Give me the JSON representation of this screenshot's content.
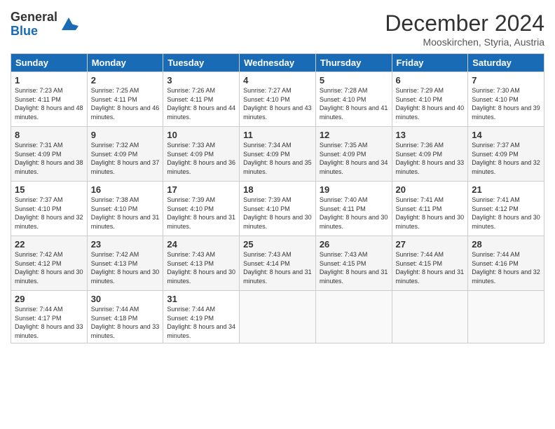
{
  "logo": {
    "general": "General",
    "blue": "Blue"
  },
  "header": {
    "month": "December 2024",
    "location": "Mooskirchen, Styria, Austria"
  },
  "weekdays": [
    "Sunday",
    "Monday",
    "Tuesday",
    "Wednesday",
    "Thursday",
    "Friday",
    "Saturday"
  ],
  "weeks": [
    [
      {
        "day": "1",
        "sunrise": "7:23 AM",
        "sunset": "4:11 PM",
        "daylight": "8 hours and 48 minutes."
      },
      {
        "day": "2",
        "sunrise": "7:25 AM",
        "sunset": "4:11 PM",
        "daylight": "8 hours and 46 minutes."
      },
      {
        "day": "3",
        "sunrise": "7:26 AM",
        "sunset": "4:11 PM",
        "daylight": "8 hours and 44 minutes."
      },
      {
        "day": "4",
        "sunrise": "7:27 AM",
        "sunset": "4:10 PM",
        "daylight": "8 hours and 43 minutes."
      },
      {
        "day": "5",
        "sunrise": "7:28 AM",
        "sunset": "4:10 PM",
        "daylight": "8 hours and 41 minutes."
      },
      {
        "day": "6",
        "sunrise": "7:29 AM",
        "sunset": "4:10 PM",
        "daylight": "8 hours and 40 minutes."
      },
      {
        "day": "7",
        "sunrise": "7:30 AM",
        "sunset": "4:10 PM",
        "daylight": "8 hours and 39 minutes."
      }
    ],
    [
      {
        "day": "8",
        "sunrise": "7:31 AM",
        "sunset": "4:09 PM",
        "daylight": "8 hours and 38 minutes."
      },
      {
        "day": "9",
        "sunrise": "7:32 AM",
        "sunset": "4:09 PM",
        "daylight": "8 hours and 37 minutes."
      },
      {
        "day": "10",
        "sunrise": "7:33 AM",
        "sunset": "4:09 PM",
        "daylight": "8 hours and 36 minutes."
      },
      {
        "day": "11",
        "sunrise": "7:34 AM",
        "sunset": "4:09 PM",
        "daylight": "8 hours and 35 minutes."
      },
      {
        "day": "12",
        "sunrise": "7:35 AM",
        "sunset": "4:09 PM",
        "daylight": "8 hours and 34 minutes."
      },
      {
        "day": "13",
        "sunrise": "7:36 AM",
        "sunset": "4:09 PM",
        "daylight": "8 hours and 33 minutes."
      },
      {
        "day": "14",
        "sunrise": "7:37 AM",
        "sunset": "4:09 PM",
        "daylight": "8 hours and 32 minutes."
      }
    ],
    [
      {
        "day": "15",
        "sunrise": "7:37 AM",
        "sunset": "4:10 PM",
        "daylight": "8 hours and 32 minutes."
      },
      {
        "day": "16",
        "sunrise": "7:38 AM",
        "sunset": "4:10 PM",
        "daylight": "8 hours and 31 minutes."
      },
      {
        "day": "17",
        "sunrise": "7:39 AM",
        "sunset": "4:10 PM",
        "daylight": "8 hours and 31 minutes."
      },
      {
        "day": "18",
        "sunrise": "7:39 AM",
        "sunset": "4:10 PM",
        "daylight": "8 hours and 30 minutes."
      },
      {
        "day": "19",
        "sunrise": "7:40 AM",
        "sunset": "4:11 PM",
        "daylight": "8 hours and 30 minutes."
      },
      {
        "day": "20",
        "sunrise": "7:41 AM",
        "sunset": "4:11 PM",
        "daylight": "8 hours and 30 minutes."
      },
      {
        "day": "21",
        "sunrise": "7:41 AM",
        "sunset": "4:12 PM",
        "daylight": "8 hours and 30 minutes."
      }
    ],
    [
      {
        "day": "22",
        "sunrise": "7:42 AM",
        "sunset": "4:12 PM",
        "daylight": "8 hours and 30 minutes."
      },
      {
        "day": "23",
        "sunrise": "7:42 AM",
        "sunset": "4:13 PM",
        "daylight": "8 hours and 30 minutes."
      },
      {
        "day": "24",
        "sunrise": "7:43 AM",
        "sunset": "4:13 PM",
        "daylight": "8 hours and 30 minutes."
      },
      {
        "day": "25",
        "sunrise": "7:43 AM",
        "sunset": "4:14 PM",
        "daylight": "8 hours and 31 minutes."
      },
      {
        "day": "26",
        "sunrise": "7:43 AM",
        "sunset": "4:15 PM",
        "daylight": "8 hours and 31 minutes."
      },
      {
        "day": "27",
        "sunrise": "7:44 AM",
        "sunset": "4:15 PM",
        "daylight": "8 hours and 31 minutes."
      },
      {
        "day": "28",
        "sunrise": "7:44 AM",
        "sunset": "4:16 PM",
        "daylight": "8 hours and 32 minutes."
      }
    ],
    [
      {
        "day": "29",
        "sunrise": "7:44 AM",
        "sunset": "4:17 PM",
        "daylight": "8 hours and 33 minutes."
      },
      {
        "day": "30",
        "sunrise": "7:44 AM",
        "sunset": "4:18 PM",
        "daylight": "8 hours and 33 minutes."
      },
      {
        "day": "31",
        "sunrise": "7:44 AM",
        "sunset": "4:19 PM",
        "daylight": "8 hours and 34 minutes."
      },
      null,
      null,
      null,
      null
    ]
  ],
  "labels": {
    "sunrise": "Sunrise:",
    "sunset": "Sunset:",
    "daylight": "Daylight:"
  }
}
